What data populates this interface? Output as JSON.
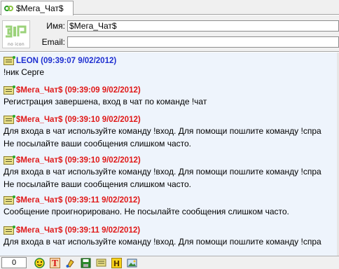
{
  "tab": {
    "label": "$Мега_Чат$",
    "icon": "double-ring-icon"
  },
  "header": {
    "logo_caption": "no icon",
    "name_label": "Имя:",
    "name_value": "$Мега_Чат$",
    "email_label": "Email:",
    "email_value": ""
  },
  "messages": [
    {
      "sender": "LEON (09:39:07 9/02/2012)",
      "color": "#1e2fd0",
      "lines": [
        "!ник Серге"
      ]
    },
    {
      "sender": "$Мега_Чат$ (09:39:09 9/02/2012)",
      "color": "#e01818",
      "lines": [
        "Регистрация завершена, вход в чат по команде !чат"
      ]
    },
    {
      "sender": "$Мега_Чат$ (09:39:10 9/02/2012)",
      "color": "#e01818",
      "lines": [
        "Для входа в чат используйте команду !вход. Для помощи пошлите команду !спра",
        "Не посылайте ваши сообщения слишком часто."
      ]
    },
    {
      "sender": "$Мега_Чат$ (09:39:10 9/02/2012)",
      "color": "#e01818",
      "lines": [
        "Для входа в чат используйте команду !вход. Для помощи пошлите команду !спра",
        "Не посылайте ваши сообщения слишком часто."
      ]
    },
    {
      "sender": "$Мега_Чат$ (09:39:11 9/02/2012)",
      "color": "#e01818",
      "lines": [
        "Сообщение проигнорировано. Не посылайте сообщения слишком часто."
      ]
    },
    {
      "sender": "$Мега_Чат$ (09:39:11 9/02/2012)",
      "color": "#e01818",
      "lines": [
        "Для входа в чат используйте команду !вход. Для помощи пошлите команду !спра"
      ]
    }
  ],
  "toolbar": {
    "counter": "0",
    "buttons": [
      "smiley-icon",
      "text-format-icon",
      "paint-icon",
      "save-icon",
      "chat-note-icon",
      "highlight-icon",
      "image-icon"
    ]
  }
}
